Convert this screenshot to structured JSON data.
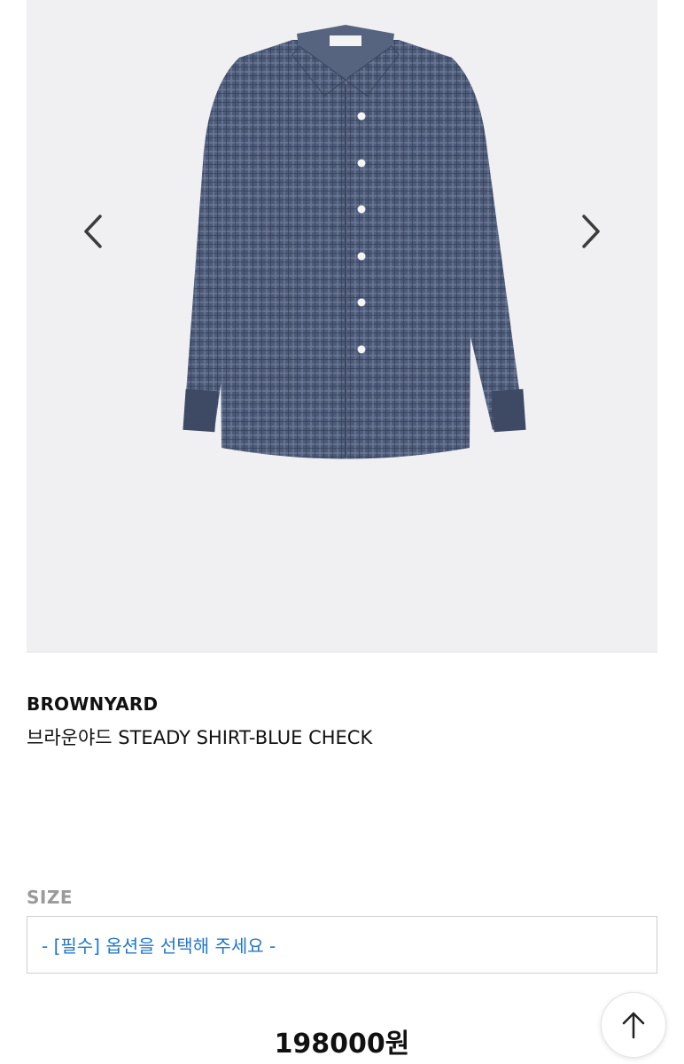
{
  "gallery": {
    "prev_icon": "chevron-left-icon",
    "next_icon": "chevron-right-icon",
    "image_subject": "blue check long-sleeve shirt"
  },
  "product": {
    "brand": "BROWNYARD",
    "name": "브라운야드 STEADY SHIRT-BLUE CHECK",
    "price": "198000원"
  },
  "options": {
    "size_label": "SIZE",
    "size_select_value": "- [필수] 옵션을 선택해 주세요 -"
  },
  "colors": {
    "accent": "#1f78c8",
    "gallery_bg": "#f0f0f3",
    "shirt": "#4d5b78"
  },
  "scroll_top_icon": "arrow-up-icon"
}
